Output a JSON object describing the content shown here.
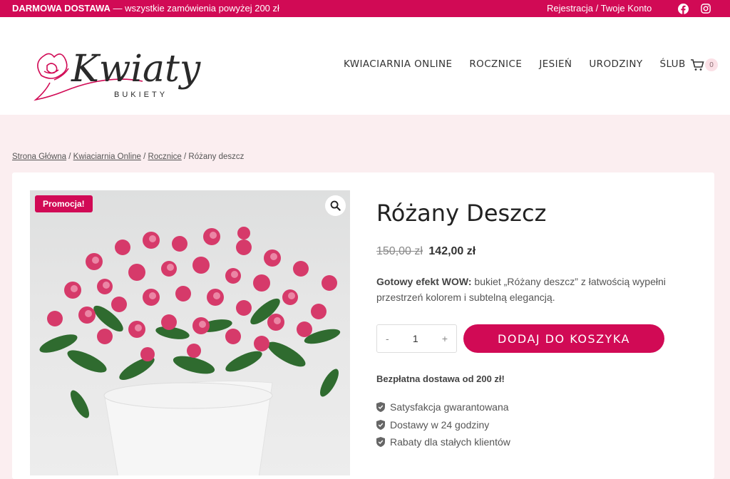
{
  "topbar": {
    "promo_bold": "DARMOWA DOSTAWA",
    "promo_text": " — wszystkie zamówienia powyżej 200 zł",
    "account": "Rejestracja / Twoje Konto",
    "icons": [
      "facebook-icon",
      "instagram-icon"
    ]
  },
  "logo": {
    "main": "Kwiaty",
    "sub": "BUKIETY"
  },
  "nav": {
    "items": [
      {
        "label": "KWIACIARNIA ONLINE"
      },
      {
        "label": "ROCZNICE"
      },
      {
        "label": "JESIEŃ"
      },
      {
        "label": "URODZINY"
      },
      {
        "label": "ŚLUB"
      }
    ],
    "cart_count": "0"
  },
  "breadcrumb": {
    "items": [
      "Strona Główna",
      "Kwiaciarnia Online",
      "Rocznice"
    ],
    "current": "Różany deszcz",
    "sep": " / "
  },
  "product": {
    "badge": "Promocja!",
    "title": "Różany Deszcz",
    "old_price": "150,00 zł",
    "new_price": "142,00 zł",
    "desc_bold": "Gotowy efekt WOW:",
    "desc_text": " bukiet „Różany deszcz” z łatwością wypełni przestrzeń kolorem i subtelną elegancją.",
    "qty_minus": "-",
    "qty_value": "1",
    "qty_plus": "+",
    "add_to_cart": "DODAJ DO KOSZYKA",
    "shipping": "Bezpłatna dostawa od 200 zł!",
    "features": [
      "Satysfakcja gwarantowana",
      "Dostawy w 24 godziny",
      "Rabaty dla stałych klientów"
    ]
  },
  "colors": {
    "accent": "#d10a55",
    "background": "#fbeef0",
    "card": "#ffffff"
  }
}
